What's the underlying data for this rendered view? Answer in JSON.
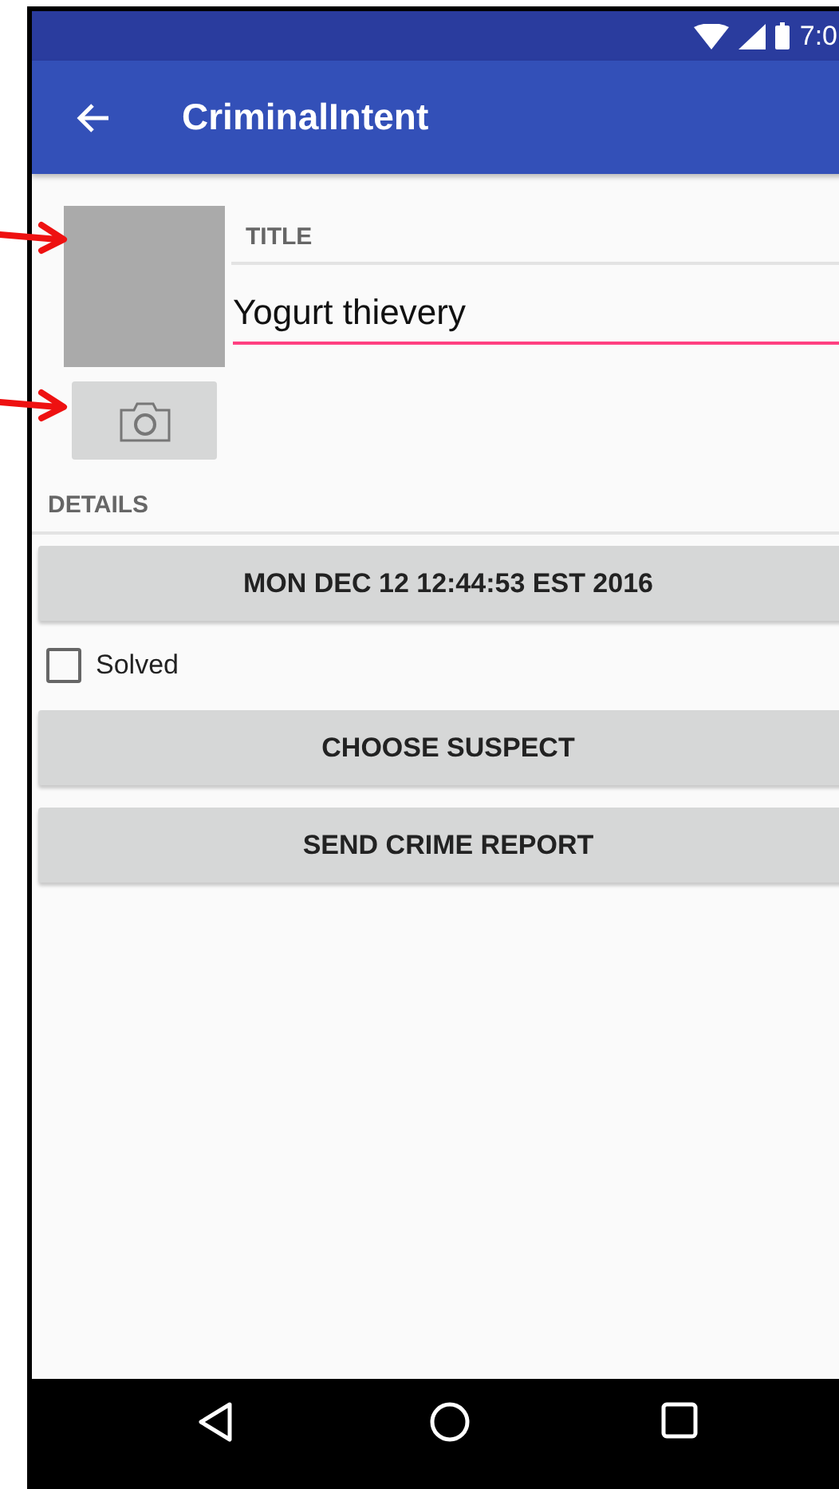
{
  "status_bar": {
    "time": "7:0"
  },
  "app_bar": {
    "title": "CriminalIntent"
  },
  "crime": {
    "title_label": "TITLE",
    "title_value": "Yogurt thievery",
    "details_label": "DETAILS",
    "date_button": "MON DEC 12 12:44:53 EST 2016",
    "solved": {
      "label": "Solved",
      "checked": false
    },
    "buttons": [
      "CHOOSE SUSPECT",
      "SEND CRIME REPORT"
    ]
  }
}
